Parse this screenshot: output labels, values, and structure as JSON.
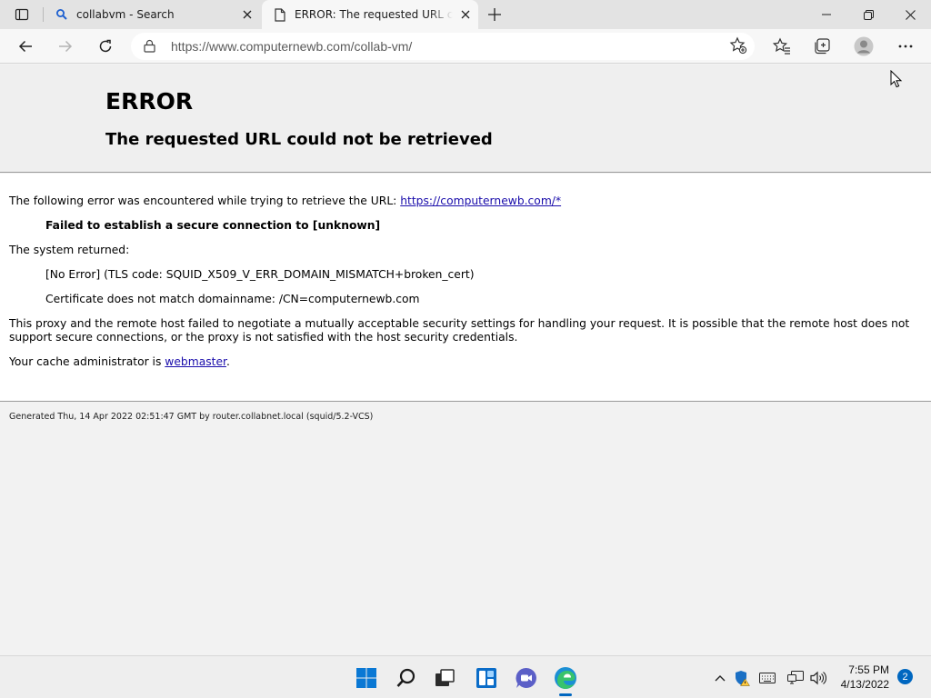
{
  "browser": {
    "tabs": [
      {
        "title": "collabvm - Search",
        "favicon": "search-icon",
        "active": false
      },
      {
        "title": "ERROR: The requested URL could not be retrieved",
        "favicon": "page-icon",
        "active": true
      }
    ],
    "url": "https://www.computernewb.com/collab-vm/"
  },
  "page": {
    "heading": "ERROR",
    "subheading": "The requested URL could not be retrieved",
    "intro_text": "The following error was encountered while trying to retrieve the URL: ",
    "intro_link": "https://computernewb.com/*",
    "error_title": "Failed to establish a secure connection to [unknown]",
    "system_returned": "The system returned:",
    "system_line1": "[No Error] (TLS code: SQUID_X509_V_ERR_DOMAIN_MISMATCH+broken_cert)",
    "system_line2": "Certificate does not match domainname: /CN=computernewb.com",
    "explanation": "This proxy and the remote host failed to negotiate a mutually acceptable security settings for handling your request. It is possible that the remote host does not support secure connections, or the proxy is not satisfied with the host security credentials.",
    "admin_text": "Your cache administrator is ",
    "admin_link": "webmaster",
    "admin_suffix": ".",
    "footer": "Generated Thu, 14 Apr 2022 02:51:47 GMT by router.collabnet.local (squid/5.2-VCS)"
  },
  "taskbar": {
    "time": "7:55 PM",
    "date": "4/13/2022",
    "notification_count": "2"
  },
  "colors": {
    "accent": "#0067c0",
    "link": "#1a0dab"
  }
}
